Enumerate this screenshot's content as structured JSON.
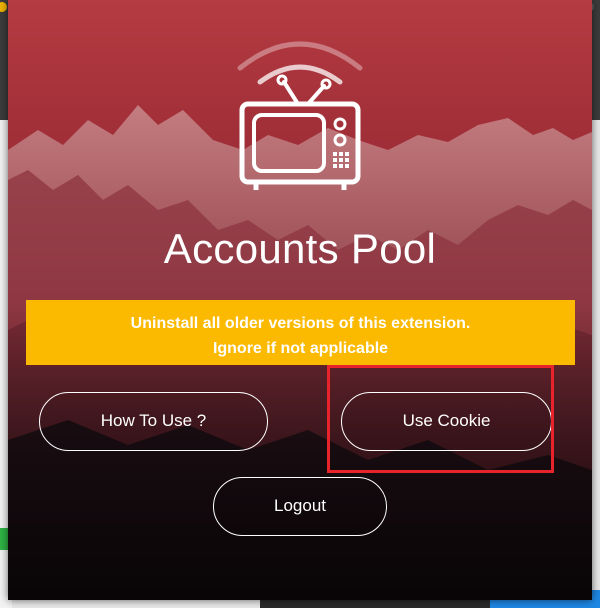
{
  "popup": {
    "title": "Accounts Pool",
    "notice": {
      "line1": "Uninstall all older versions of this extension.",
      "line2": "Ignore if not applicable"
    },
    "buttons": {
      "how_to_use": "How To Use ?",
      "use_cookie": "Use Cookie",
      "logout": "Logout"
    },
    "logo_icon": "tv-antenna-signal-icon"
  },
  "colors": {
    "notice_bg": "#fbb900",
    "highlight": "#e8232b",
    "text": "#ffffff"
  }
}
